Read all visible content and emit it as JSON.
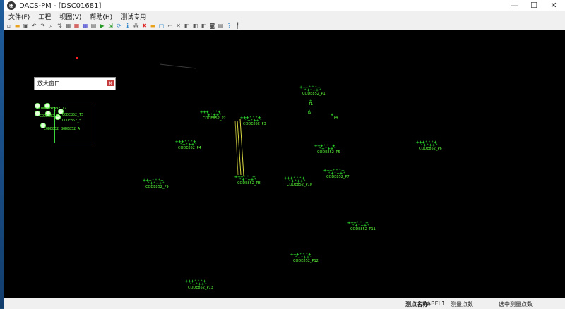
{
  "window": {
    "title": "DACS-PM - [DSC01681]",
    "app_icon": "dacs-app-icon"
  },
  "controls": {
    "minimize": "—",
    "maximize": "☐",
    "close": "✕"
  },
  "menu": [
    {
      "label": "文件(F)"
    },
    {
      "label": "工程"
    },
    {
      "label": "视图(V)"
    },
    {
      "label": "帮助(H)"
    },
    {
      "label": "测试专用"
    }
  ],
  "toolbar_icons": [
    "new-file-icon",
    "open-folder-icon",
    "select-icon",
    "undo-icon",
    "redo-icon",
    "zoom-icon",
    "measure-icon",
    "grid-icon",
    "grid-red-icon",
    "grid-blue-icon",
    "layers-icon",
    "run-icon",
    "export-icon",
    "refresh-icon",
    "info-icon",
    "tool-a-icon",
    "stop-icon",
    "folder-icon",
    "window-icon",
    "crop-icon",
    "cross-icon",
    "node-a-icon",
    "node-b-icon",
    "node-c-icon",
    "camera-icon",
    "calc-icon",
    "help-icon",
    "pin-icon"
  ],
  "zoom_window": {
    "title": "放大窗口",
    "close": "x",
    "labels": [
      "CODE852_17",
      "CODE852_T5",
      "CODE852_5",
      "CODE852_6",
      "CODE852_3",
      "CODE852_BODE852_A"
    ]
  },
  "clusters": [
    {
      "label": "CODE852_P1"
    },
    {
      "label": "CODE852_P2"
    },
    {
      "label": "CODE852_P3"
    },
    {
      "label": "CODE852_P4"
    },
    {
      "label": "CODE852_P5"
    },
    {
      "label": "CODE852_P6"
    },
    {
      "label": "CODE852_P7"
    },
    {
      "label": "CODE852_P8"
    },
    {
      "label": "CODE852_P9"
    },
    {
      "label": "CODE852_P10"
    },
    {
      "label": "CODE852_P11"
    },
    {
      "label": "CODE852_P12"
    },
    {
      "label": "CODE852_P13"
    }
  ],
  "singles": [
    "T1",
    "T2",
    "T4"
  ],
  "status": {
    "point_name_label": "测点名称:",
    "point_name_value": "LABEL1",
    "measure_count": "测量点数",
    "selected_count": "选中测量点数"
  },
  "colors": {
    "canvas_bg": "#000000",
    "target_green": "#33ff33",
    "window_chrome": "#f0f0f0"
  }
}
